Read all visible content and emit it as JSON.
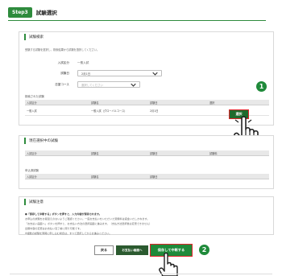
{
  "header": {
    "step": "Step3",
    "title": "試験選択"
  },
  "exam_search": {
    "title": "試験検索",
    "description": "受験する試験を選択し、検索結果から試験を選択してください。",
    "entry_type_label": "入試区分",
    "entry_type_value": "一般入試",
    "exam_category_label": "試験日",
    "exam_category_value": "2月1日",
    "exam_date_label": "志望コース",
    "exam_date_placeholder": "選択してください",
    "results_label": "検索された試験",
    "columns": [
      "入試区分",
      "試験名",
      "試験日",
      "選択"
    ],
    "rows": [
      {
        "entry": "一般入試",
        "exam": "一般入試（グローバルコース）",
        "date": "2月1日"
      }
    ],
    "select_label": "選択"
  },
  "selected": {
    "title": "現在選択中の試験",
    "columns": [
      "入試区分",
      "試験名",
      "試験日",
      "試験料"
    ],
    "applied_label": "申込済試験",
    "applied_columns": [
      "入試区分",
      "試験名",
      "試験日"
    ]
  },
  "notice": {
    "title": "試験注意",
    "lines": [
      "●「保存して中断する」ボタンを押すと、入力内容が保存されます。",
      "お申込の試験をお間違えのないようご確認ください。一度お支払いをいただいた受験料は返金いたしかねます。",
      "「お支払い画面へ」ボタンを押すと、お支払い方法の選択画面に進みます。（支払方法選択後は変更できません）",
      "出願内容の変更はお支払い完了前に限り可能です。",
      "※複数の試験を同時に申し込む場合は、すべて選択してからお進みください。"
    ]
  },
  "footer": {
    "back_label": "戻る",
    "pay_label": "お支払い画面へ",
    "save_label": "保存して中断する"
  },
  "callouts": {
    "first": "1",
    "second": "2"
  }
}
